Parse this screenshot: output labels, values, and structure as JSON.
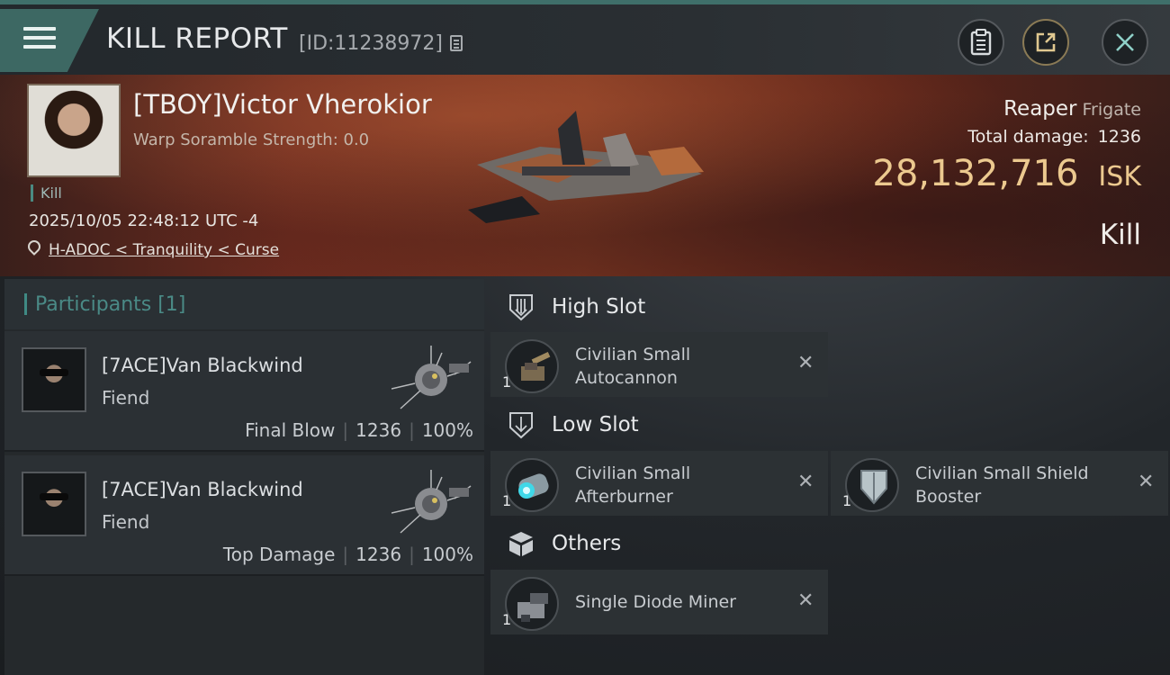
{
  "header": {
    "title": "KILL REPORT",
    "report_id": "[ID:11238972]",
    "icons": [
      "menu-icon",
      "copy-icon",
      "clipboard-icon",
      "share-icon",
      "close-icon"
    ]
  },
  "victim": {
    "name": "[TBOY]Victor Vherokior",
    "warp_scramble": "Warp Soramble Strength: 0.0",
    "kill_tag": "Kill",
    "datetime": "2025/10/05 22:48:12 UTC -4",
    "location": "H-ADOC < Tranquility < Curse",
    "ship_name": "Reaper",
    "ship_class": "Frigate",
    "total_damage_label": "Total damage:",
    "total_damage": "1236",
    "isk_value": "28,132,716",
    "isk_unit": "ISK",
    "result": "Kill"
  },
  "participants": {
    "header": "Participants [1]",
    "list": [
      {
        "name": "[7ACE]Van Blackwind",
        "ship": "Fiend",
        "role": "Final Blow",
        "damage": "1236",
        "percent": "100%"
      },
      {
        "name": "[7ACE]Van Blackwind",
        "ship": "Fiend",
        "role": "Top Damage",
        "damage": "1236",
        "percent": "100%"
      }
    ]
  },
  "fitting": {
    "high_slot": {
      "label": "High Slot",
      "modules": [
        {
          "name_line1": "Civilian Small",
          "name_line2": "Autocannon",
          "qty": "1"
        }
      ]
    },
    "low_slot": {
      "label": "Low Slot",
      "modules": [
        {
          "name_line1": "Civilian Small",
          "name_line2": "Afterburner",
          "qty": "1"
        },
        {
          "name_line1": "Civilian Small Shield",
          "name_line2": "Booster",
          "qty": "1"
        }
      ]
    },
    "others": {
      "label": "Others",
      "modules": [
        {
          "name_line1": "Single Diode Miner",
          "qty": "1"
        }
      ]
    },
    "remove_symbol": "✕"
  },
  "colors": {
    "accent_teal": "#3d6863",
    "isk_gold": "#ecc98f",
    "banner_red": "#6b2a1e"
  }
}
